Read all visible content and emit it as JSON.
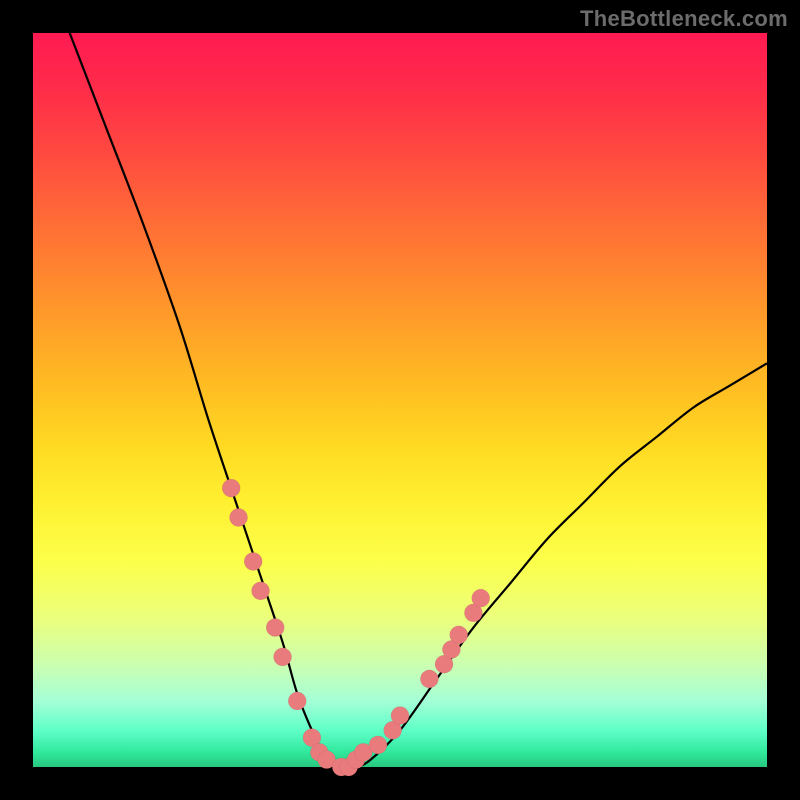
{
  "watermark": "TheBottleneck.com",
  "chart_data": {
    "type": "line",
    "title": "",
    "xlabel": "",
    "ylabel": "",
    "xlim": [
      0,
      100
    ],
    "ylim": [
      0,
      100
    ],
    "note": "Axes unlabeled in source image; values estimated from pixel positions. y represents bottleneck % (0 at bottom). Curve descends steeply from left, reaches ~0 around x≈40, rises to ~55 at right edge.",
    "series": [
      {
        "name": "bottleneck-curve",
        "x": [
          5,
          10,
          15,
          20,
          24,
          28,
          31,
          34,
          36,
          38,
          40,
          42,
          44,
          46,
          50,
          55,
          60,
          65,
          70,
          75,
          80,
          85,
          90,
          95,
          100
        ],
        "y": [
          100,
          87,
          74,
          60,
          47,
          35,
          26,
          17,
          10,
          5,
          1,
          0,
          0,
          1,
          5,
          12,
          19,
          25,
          31,
          36,
          41,
          45,
          49,
          52,
          55
        ]
      }
    ],
    "points": {
      "name": "highlighted-dots",
      "note": "Salmon-colored dots clustered near valley and on both rising arms.",
      "coords": [
        [
          27,
          38
        ],
        [
          28,
          34
        ],
        [
          30,
          28
        ],
        [
          31,
          24
        ],
        [
          33,
          19
        ],
        [
          34,
          15
        ],
        [
          36,
          9
        ],
        [
          38,
          4
        ],
        [
          39,
          2
        ],
        [
          40,
          1
        ],
        [
          42,
          0
        ],
        [
          43,
          0
        ],
        [
          44,
          1
        ],
        [
          45,
          2
        ],
        [
          47,
          3
        ],
        [
          49,
          5
        ],
        [
          50,
          7
        ],
        [
          54,
          12
        ],
        [
          56,
          14
        ],
        [
          57,
          16
        ],
        [
          58,
          18
        ],
        [
          60,
          21
        ],
        [
          61,
          23
        ]
      ]
    },
    "colors": {
      "curve": "#000000",
      "dots": "#e97b7d",
      "gradient_top": "#ff1a52",
      "gradient_bottom": "#28c87e"
    }
  }
}
